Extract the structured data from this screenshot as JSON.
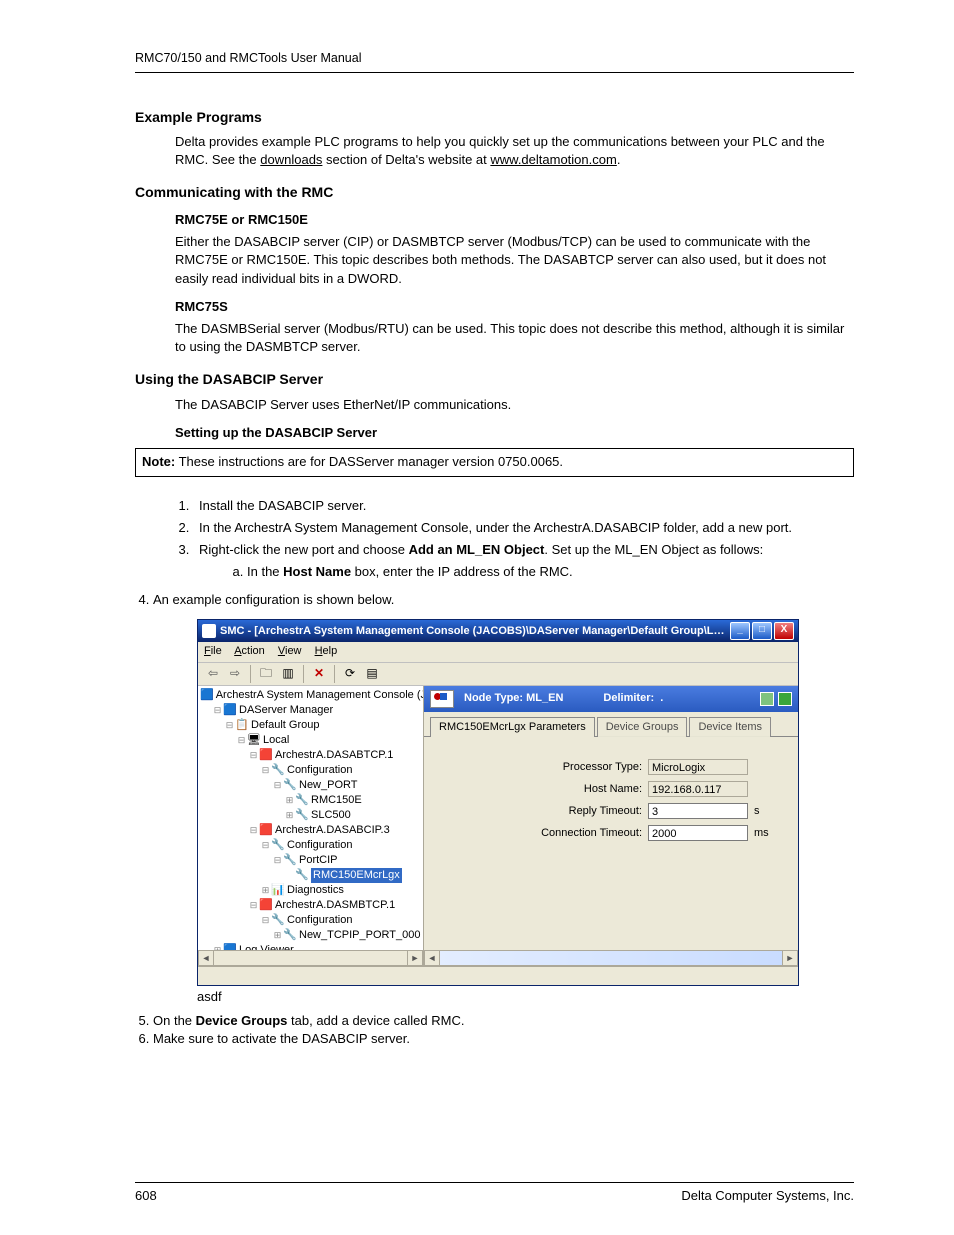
{
  "header_title": "RMC70/150 and RMCTools User Manual",
  "sections": {
    "example_programs": {
      "heading": "Example Programs",
      "p1a": "Delta provides example PLC programs to help you quickly set up the communications between your PLC and the RMC. See the ",
      "link1": "downloads",
      "p1b": " section of Delta's website at ",
      "link2": "www.deltamotion.com",
      "p1c": "."
    },
    "communicating": {
      "heading": "Communicating with the RMC",
      "sub1_heading": "RMC75E or RMC150E",
      "sub1_body": "Either the DASABCIP server (CIP) or DASMBTCP server (Modbus/TCP) can be used to communicate with the RMC75E or RMC150E. This topic describes both methods. The DASABTCP server can also used, but it does not easily read individual bits in a DWORD.",
      "sub2_heading": "RMC75S",
      "sub2_body": "The DASMBSerial server (Modbus/RTU) can be used. This topic does not describe this method, although it is similar to using the DASMBTCP server."
    },
    "using_server": {
      "heading": "Using the DASABCIP Server",
      "body": "The DASABCIP Server uses EtherNet/IP communications.",
      "setup_heading": "Setting up the DASABCIP Server",
      "note_label": "Note:",
      "note_body": " These instructions are for DASServer manager version 0750.0065.",
      "steps": {
        "s1": "Install the DASABCIP server.",
        "s2": "In the ArchestrA System Management Console, under the ArchestrA.DASABCIP folder, add a new port.",
        "s3a": "Right-click the new port and choose ",
        "s3b": "Add an ML_EN Object",
        "s3c": ". Set up the ML_EN Object as follows:",
        "s3_a1": "In the ",
        "s3_a2": "Host Name",
        "s3_a3": " box, enter the IP address of the RMC.",
        "s4": "An example configuration is shown below.",
        "s5a": "On the ",
        "s5b": "Device Groups",
        "s5c": " tab, add a device called RMC.",
        "s6": "Make sure to activate the DASABCIP server."
      },
      "asdf": "asdf"
    }
  },
  "smc": {
    "title": "SMC - [ArchestrA System Management Console (JACOBS)\\DAServer Manager\\Default Group\\Local\\...",
    "menus": {
      "file": "File",
      "action": "Action",
      "view": "View",
      "help": "Help"
    },
    "tree": {
      "root": "ArchestrA System Management Console (JACOBS)",
      "das_mgr": "DAServer Manager",
      "def_group": "Default Group",
      "local": "Local",
      "abtcp": "ArchestrA.DASABTCP.1",
      "config1": "Configuration",
      "new_port": "New_PORT",
      "rmc150e": "RMC150E",
      "slc500": "SLC500",
      "abcip": "ArchestrA.DASABCIP.3",
      "config2": "Configuration",
      "portcip": "PortCIP",
      "sel": "RMC150EMcrLgx",
      "diag": "Diagnostics",
      "mbtcp": "ArchestrA.DASMBTCP.1",
      "config3": "Configuration",
      "new_tcp": "New_TCPIP_PORT_000",
      "logv": "Log Viewer"
    },
    "banner": {
      "node_type_label": "Node Type: ",
      "node_type_val": "ML_EN",
      "delim_label": "Delimiter:",
      "delim_val": "."
    },
    "tabs": {
      "t1": "RMC150EMcrLgx Parameters",
      "t2": "Device Groups",
      "t3": "Device Items"
    },
    "form": {
      "proc_label": "Processor Type:",
      "proc_val": "MicroLogix",
      "host_label": "Host Name:",
      "host_val": "192.168.0.117",
      "reply_label": "Reply Timeout:",
      "reply_val": "3",
      "reply_unit": "s",
      "conn_label": "Connection Timeout:",
      "conn_val": "2000",
      "conn_unit": "ms"
    }
  },
  "footer": {
    "page": "608",
    "company": "Delta Computer Systems, Inc."
  }
}
